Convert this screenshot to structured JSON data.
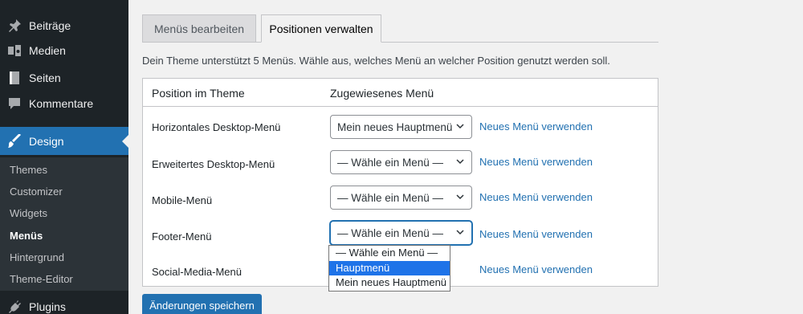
{
  "sidebar": {
    "top_items": [
      {
        "label": "Beiträge",
        "icon": "pin-icon"
      },
      {
        "label": "Medien",
        "icon": "media-icon"
      },
      {
        "label": "Seiten",
        "icon": "page-icon"
      },
      {
        "label": "Kommentare",
        "icon": "comment-icon"
      },
      {
        "label": "Design",
        "icon": "brush-icon",
        "active": true
      },
      {
        "label": "Plugins",
        "icon": "plugin-icon"
      }
    ],
    "submenu": [
      {
        "label": "Themes"
      },
      {
        "label": "Customizer"
      },
      {
        "label": "Widgets"
      },
      {
        "label": "Menüs",
        "current": true
      },
      {
        "label": "Hintergrund"
      },
      {
        "label": "Theme-Editor"
      }
    ]
  },
  "tabs": [
    {
      "label": "Menüs bearbeiten",
      "active": false
    },
    {
      "label": "Positionen verwalten",
      "active": true
    }
  ],
  "description": "Dein Theme unterstützt 5 Menüs. Wähle aus, welches Menü an welcher Position genutzt werden soll.",
  "table": {
    "headers": [
      "Position im Theme",
      "Zugewiesenes Menü"
    ],
    "rows": [
      {
        "position": "Horizontales Desktop-Menü",
        "selected": "Mein neues Hauptmenü",
        "link": "Neues Menü verwenden"
      },
      {
        "position": "Erweitertes Desktop-Menü",
        "selected": "— Wähle ein Menü —",
        "link": "Neues Menü verwenden"
      },
      {
        "position": "Mobile-Menü",
        "selected": "— Wähle ein Menü —",
        "link": "Neues Menü verwenden"
      },
      {
        "position": "Footer-Menü",
        "selected": "— Wähle ein Menü —",
        "link": "Neues Menü verwenden"
      },
      {
        "position": "Social-Media-Menü",
        "selected": "",
        "link": "Neues Menü verwenden"
      }
    ]
  },
  "dropdown": {
    "options": [
      "— Wähle ein Menü —",
      "Hauptmenü",
      "Mein neues Hauptmenü"
    ],
    "highlighted": "Hauptmenü"
  },
  "save_button": "Änderungen speichern",
  "colors": {
    "accent": "#2271b1",
    "sidebar": "#1d2327",
    "submenu": "#2c3338",
    "highlight": "#1e73e8"
  }
}
